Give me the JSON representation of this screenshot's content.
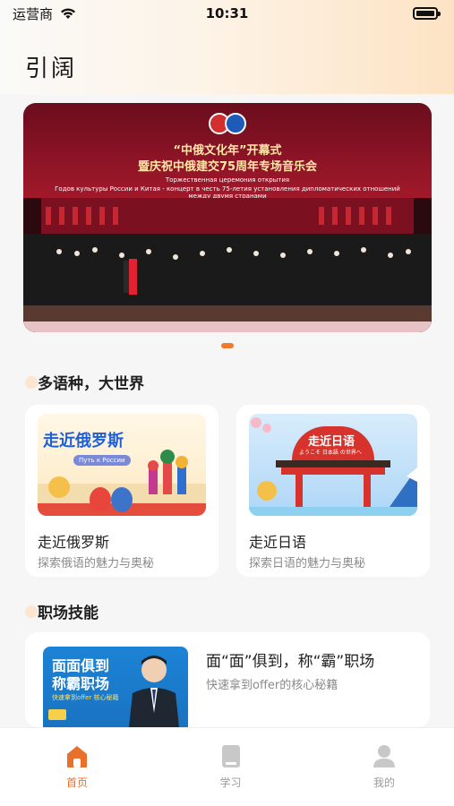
{
  "status": {
    "carrier": "运营商",
    "time": "10:31"
  },
  "header": {
    "title": "引阔"
  },
  "banner": {
    "line1": "“中俄文化年”开幕式",
    "line2": "暨庆祝中俄建交75周年专场音乐会",
    "line3": "Торжественная церемония открытия",
    "line4": "Годов культуры России и Китая - концерт в честь 75-летия установления дипломатических отношений между двумя странами"
  },
  "languages": {
    "section_title": "多语种，大世界",
    "cards": [
      {
        "title": "走近俄罗斯",
        "subtitle": "探索俄语的魅力与奥秘",
        "banner_text": "走近俄罗斯",
        "banner_caption": "Путь к России"
      },
      {
        "title": "走近日语",
        "subtitle": "探索日语的魅力与奥秘",
        "banner_text": "走近日语",
        "banner_caption": "ようこそ 日本語 の世界へ"
      }
    ]
  },
  "career": {
    "section_title": "职场技能",
    "card": {
      "title": "面“面”俱到，称“霸”职场",
      "subtitle": "快速拿到offer的核心秘籍",
      "banner_line1": "面面俱到",
      "banner_line2": "称霸职场",
      "banner_tag": "快速拿到offer 核心秘籍"
    }
  },
  "tabbar": {
    "items": [
      {
        "label": "首页",
        "icon": "home-icon",
        "active": true
      },
      {
        "label": "学习",
        "icon": "book-icon",
        "active": false
      },
      {
        "label": "我的",
        "icon": "user-icon",
        "active": false
      }
    ]
  },
  "colors": {
    "accent": "#e8702a",
    "pager": "#f07a2c"
  }
}
